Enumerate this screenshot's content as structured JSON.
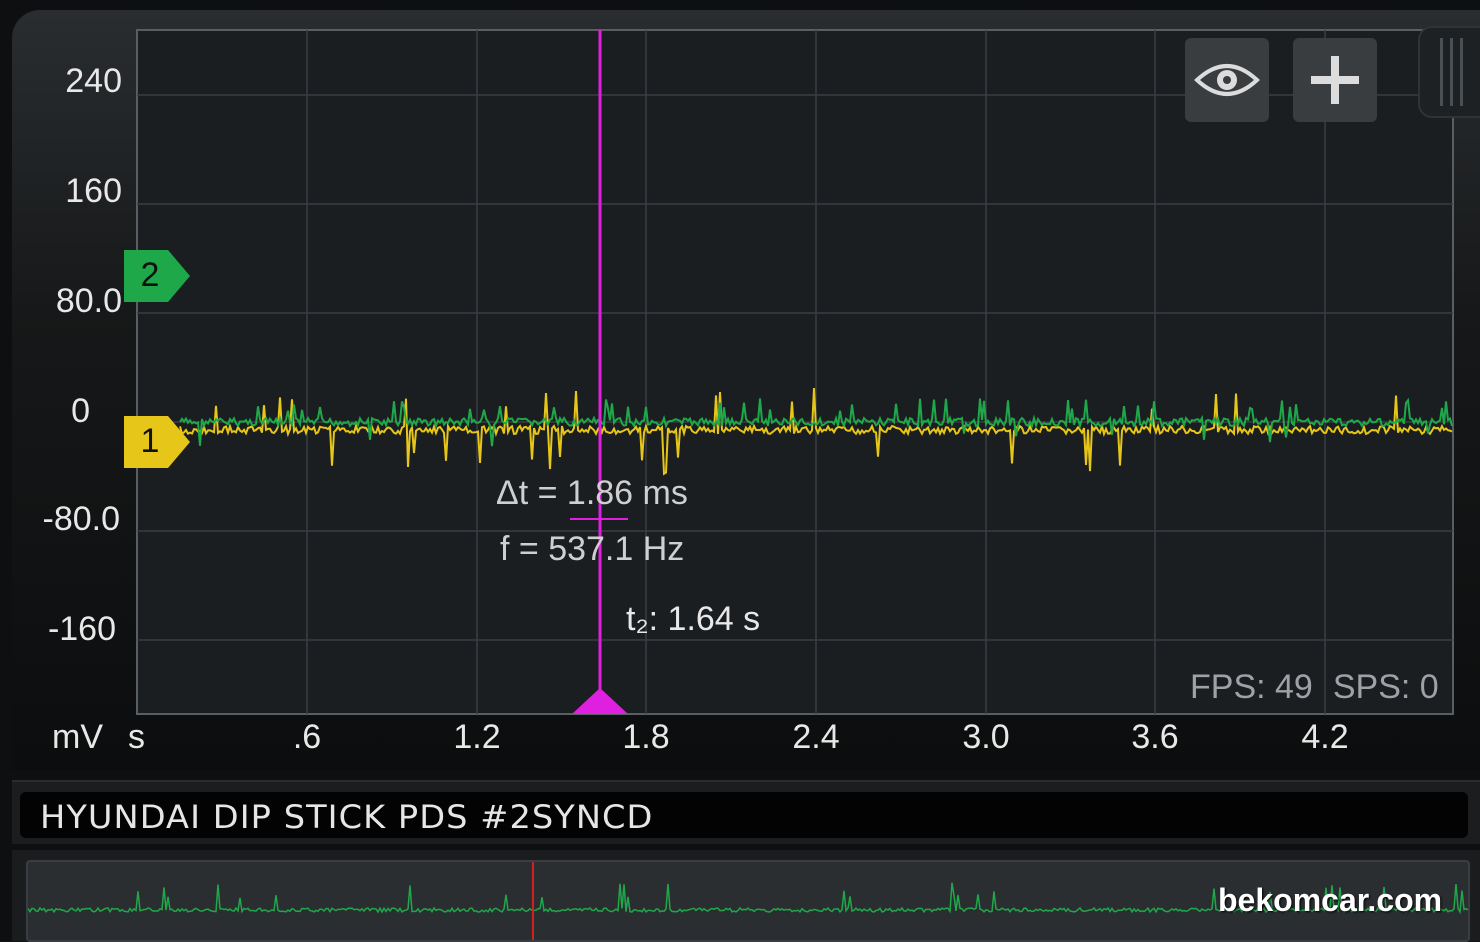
{
  "y_axis": {
    "ticks": [
      "240",
      "160",
      "80.0",
      "0",
      "-80.0",
      "-160"
    ],
    "unit": "mV"
  },
  "x_axis": {
    "unit": "s",
    "ticks": [
      ".6",
      "1.2",
      "1.8",
      "2.4",
      "3.0",
      "3.6",
      "4.2"
    ]
  },
  "channels": [
    {
      "id": "1",
      "color": "#e6c619",
      "label": "1"
    },
    {
      "id": "2",
      "color": "#1fa84a",
      "label": "2"
    }
  ],
  "cursor": {
    "color": "#e020e0"
  },
  "measurement": {
    "delta_t": "Δt = 1.86 ms",
    "frequency": "f = 537.1 Hz",
    "t2_label": "t₂: 1.64 s"
  },
  "stats": {
    "fps": "FPS: 49",
    "sps": "SPS: 0"
  },
  "toolbar": {
    "visibility_icon": "eye-icon",
    "add_icon": "plus-icon"
  },
  "title": "HYUNDAI DIP STICK PDS #2SYNCD",
  "watermark": "bekomcar.com"
}
